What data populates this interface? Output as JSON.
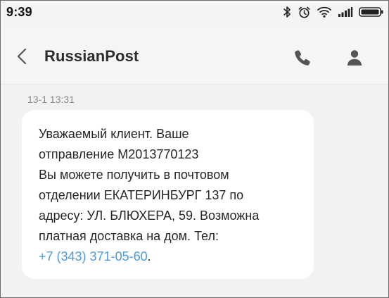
{
  "status_bar": {
    "time": "9:39",
    "icons": [
      "bluetooth-icon",
      "alarm-icon",
      "wifi-icon",
      "signal-icon",
      "battery-icon"
    ]
  },
  "header": {
    "contact_name": "RussianPost",
    "icons": [
      "back-arrow-icon",
      "phone-icon",
      "person-icon"
    ]
  },
  "conversation": {
    "timestamp": "13-1 13:31",
    "message": {
      "lines": [
        "Уважаемый клиент. Ваше",
        "отправление M2013770123",
        "Вы можете получить в почтовом",
        "отделении ЕКАТЕРИНБУРГ 137 по",
        "адресу: УЛ. БЛЮХЕРА, 59. Возможна",
        "платная доставка на дом. Тел:"
      ],
      "phone_number": "+7 (343) 371-05-60",
      "phone_suffix": "."
    }
  },
  "colors": {
    "link": "#4a9bdd",
    "bubble": "#ffffff",
    "background": "#f2f2f2",
    "text": "#262626"
  }
}
